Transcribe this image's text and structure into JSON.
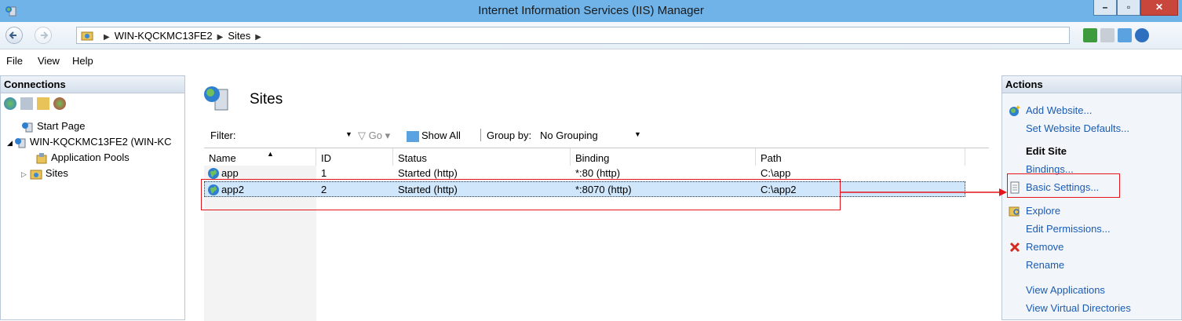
{
  "window": {
    "title": "Internet Information Services (IIS) Manager"
  },
  "address": {
    "crumbs": [
      "WIN-KQCKMC13FE2",
      "Sites"
    ]
  },
  "menu": {
    "items": [
      "File",
      "View",
      "Help"
    ]
  },
  "connections": {
    "title": "Connections",
    "tree": {
      "start_page": "Start Page",
      "server": "WIN-KQCKMC13FE2 (WIN-KC",
      "app_pools": "Application Pools",
      "sites": "Sites"
    }
  },
  "center": {
    "title": "Sites",
    "filter": {
      "label": "Filter:",
      "go": "Go",
      "show_all": "Show All",
      "group_by_label": "Group by:",
      "group_by_value": "No Grouping"
    },
    "columns": [
      "Name",
      "ID",
      "Status",
      "Binding",
      "Path"
    ],
    "rows": [
      {
        "name": "app",
        "id": "1",
        "status": "Started (http)",
        "binding": "*:80 (http)",
        "path": "C:\\app"
      },
      {
        "name": "app2",
        "id": "2",
        "status": "Started (http)",
        "binding": "*:8070 (http)",
        "path": "C:\\app2"
      }
    ]
  },
  "actions": {
    "title": "Actions",
    "add_website": "Add Website...",
    "set_defaults": "Set Website Defaults...",
    "edit_site": "Edit Site",
    "bindings": "Bindings...",
    "basic_settings": "Basic Settings...",
    "explore": "Explore",
    "edit_permissions": "Edit Permissions...",
    "remove": "Remove",
    "rename": "Rename",
    "view_applications": "View Applications",
    "view_virtual_dirs": "View Virtual Directories"
  },
  "colors": {
    "accent_link": "#1a5bb4",
    "highlight": "#e3151a",
    "selection": "#cfe6fb"
  }
}
